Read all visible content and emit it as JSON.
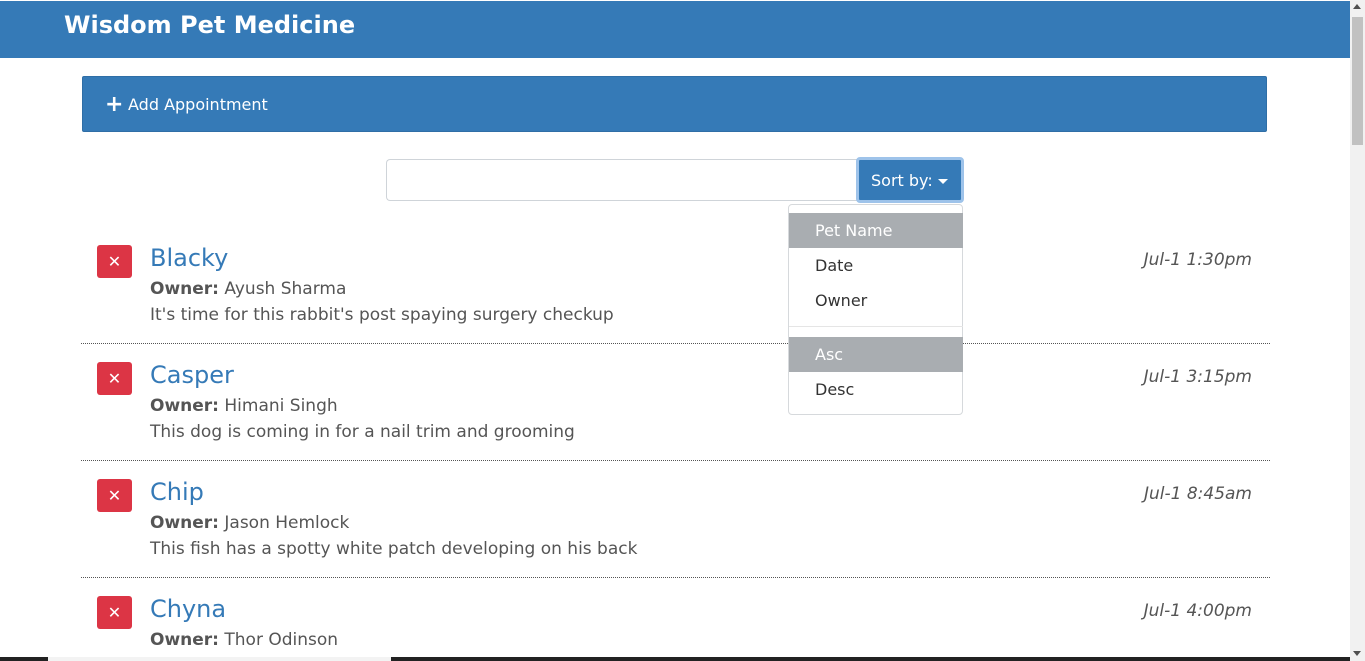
{
  "header": {
    "brand": "Wisdom Pet Medicine"
  },
  "add_panel": {
    "icon": "plus-icon",
    "label": "Add Appointment"
  },
  "search": {
    "value": "",
    "placeholder": ""
  },
  "sort": {
    "button_label": "Sort by:",
    "options": [
      {
        "label": "Pet Name",
        "active": true
      },
      {
        "label": "Date",
        "active": false
      },
      {
        "label": "Owner",
        "active": false
      }
    ],
    "order_options": [
      {
        "label": "Asc",
        "active": true
      },
      {
        "label": "Desc",
        "active": false
      }
    ]
  },
  "appointments": [
    {
      "petName": "Blacky",
      "ownerLabel": "Owner:",
      "ownerName": "Ayush Sharma",
      "notes": "It's time for this rabbit's post spaying surgery checkup",
      "date": "Jul-1 1:30pm"
    },
    {
      "petName": "Casper",
      "ownerLabel": "Owner:",
      "ownerName": "Himani Singh",
      "notes": "This dog is coming in for a nail trim and grooming",
      "date": "Jul-1 3:15pm"
    },
    {
      "petName": "Chip",
      "ownerLabel": "Owner:",
      "ownerName": "Jason Hemlock",
      "notes": "This fish has a spotty white patch developing on his back",
      "date": "Jul-1 8:45am"
    },
    {
      "petName": "Chyna",
      "ownerLabel": "Owner:",
      "ownerName": "Thor Odinson",
      "notes": "",
      "date": "Jul-1 4:00pm"
    }
  ],
  "icons": {
    "delete": "close-icon",
    "caret": "caret-down-icon"
  },
  "colors": {
    "primary": "#357ab7",
    "danger": "#dc3545",
    "active_item": "#a9adb1"
  }
}
